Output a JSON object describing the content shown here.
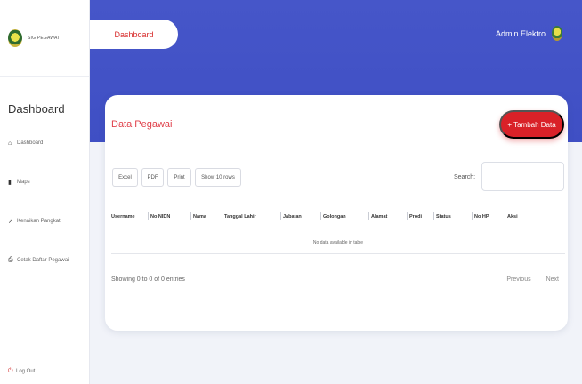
{
  "sidebar": {
    "brand": "SIG PEGAWAI",
    "title": "Dashboard",
    "items": [
      {
        "icon": "home-icon",
        "glyph": "⌂",
        "label": "Dashboard"
      },
      {
        "icon": "map-icon",
        "glyph": "▮",
        "label": "Maps"
      },
      {
        "icon": "chart-icon",
        "glyph": "↗",
        "label": "Kenaikan Pangkat"
      },
      {
        "icon": "print-icon",
        "glyph": "⎙",
        "label": "Cetak Daftar Pegawai"
      }
    ],
    "logout": {
      "icon": "power-icon",
      "glyph": "⏻",
      "label": "Log Out"
    }
  },
  "header": {
    "tab_label": "Dashboard",
    "user_name": "Admin Elektro"
  },
  "card": {
    "title": "Data Pegawai",
    "add_button": "+ Tambah Data",
    "tools": [
      "Excel",
      "PDF",
      "Print",
      "Show 10 rows"
    ],
    "search_label": "Search:",
    "search_value": "",
    "columns": [
      "Username",
      "No NIDN",
      "Nama",
      "Tanggal Lahir",
      "Jabatan",
      "Golongan",
      "Alamat",
      "Prodi",
      "Status",
      "No HP",
      "Aksi"
    ],
    "empty_text": "No data available in table",
    "info": "Showing 0 to 0 of 0 entries",
    "prev": "Previous",
    "next": "Next"
  },
  "colors": {
    "header": "#4353c6",
    "accent": "#d92128",
    "title": "#e0404a"
  }
}
